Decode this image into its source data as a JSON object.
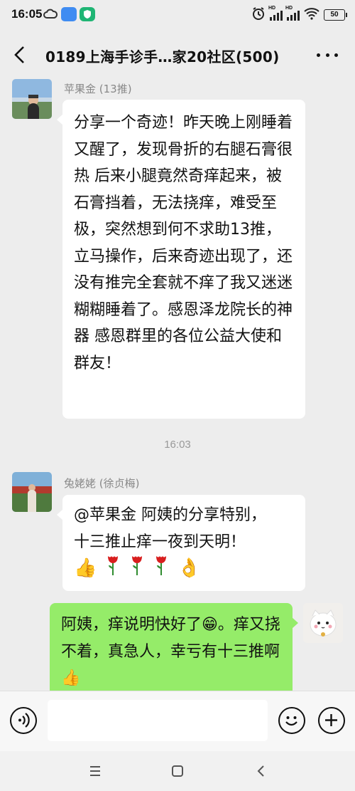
{
  "status_bar": {
    "time": "16:05",
    "network_1": "HD",
    "network_2": "HD",
    "battery": "50"
  },
  "header": {
    "title": "0189上海手诊手…家20社区(500)"
  },
  "messages": [
    {
      "sender": "苹果金 (13推)",
      "text": "分享一个奇迹！昨天晚上刚睡着又醒了，发现骨折的右腿石膏很热 后来小腿竟然奇痒起来，被石膏挡着，无法挠痒，难受至极，突然想到何不求助13推，立马操作，后来奇迹出现了，还没有推完全套就不痒了我又迷迷糊糊睡着了。感恩泽龙院长的神器 感恩群里的各位公益大使和群友！"
    },
    {
      "timestamp": "16:03"
    },
    {
      "sender": "兔姥姥 (徐贞梅)",
      "line1": "@苹果金  阿姨的分享特别，",
      "line2": "十三推止痒一夜到天明！",
      "emojis": [
        "👍",
        "🌹",
        "🌹",
        "🌹",
        "👌"
      ]
    },
    {
      "text": "阿姨，痒说明快好了😁。痒又挠不着，真急人，幸亏有十三推啊👍"
    }
  ],
  "input_bar": {
    "placeholder": ""
  },
  "colors": {
    "background": "#ededed",
    "self_bubble": "#95ec69",
    "other_bubble": "#ffffff",
    "sender_name": "#888888"
  }
}
